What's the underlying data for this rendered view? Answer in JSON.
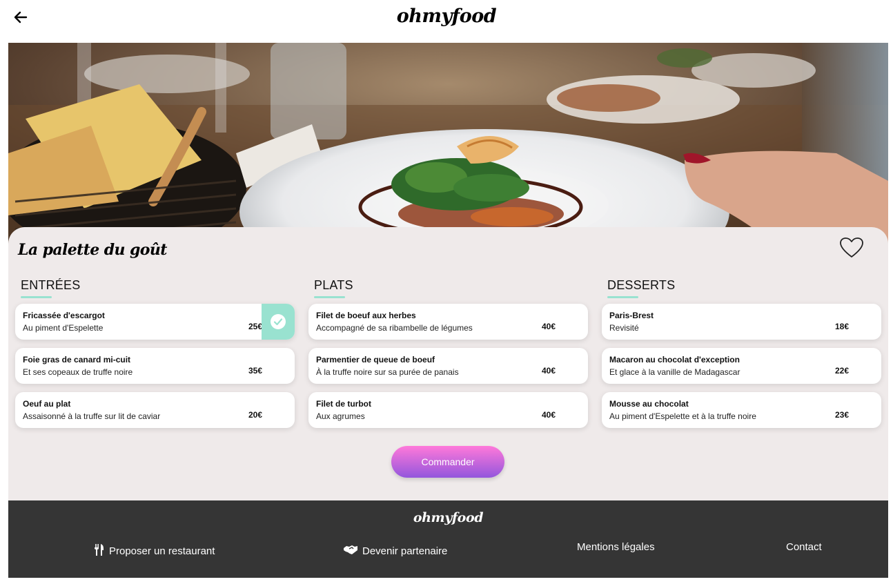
{
  "header": {
    "logo": "ohmyfood"
  },
  "restaurant": {
    "name": "La palette du goût"
  },
  "menu": {
    "columns": [
      {
        "title": "ENTRÉES",
        "items": [
          {
            "name": "Fricassée d'escargot",
            "description": "Au piment d'Espelette",
            "price": "25€",
            "selected": true
          },
          {
            "name": "Foie gras de canard mi-cuit",
            "description": "Et ses copeaux de truffe noire",
            "price": "35€",
            "selected": false
          },
          {
            "name": "Oeuf au plat",
            "description": "Assaisonné à la truffe sur lit de caviar",
            "price": "20€",
            "selected": false
          }
        ]
      },
      {
        "title": "PLATS",
        "items": [
          {
            "name": "Filet de boeuf aux herbes",
            "description": "Accompagné de sa ribambelle de légumes",
            "price": "40€",
            "selected": false
          },
          {
            "name": "Parmentier de queue de boeuf",
            "description": "À la truffe noire sur sa purée de panais",
            "price": "40€",
            "selected": false
          },
          {
            "name": "Filet de turbot",
            "description": "Aux agrumes",
            "price": "40€",
            "selected": false
          }
        ]
      },
      {
        "title": "DESSERTS",
        "items": [
          {
            "name": "Paris-Brest",
            "description": "Revisité",
            "price": "18€",
            "selected": false
          },
          {
            "name": "Macaron au chocolat d'exception",
            "description": "Et glace à la vanille de Madagascar",
            "price": "22€",
            "selected": false
          },
          {
            "name": "Mousse au chocolat",
            "description": "Au piment d'Espelette et à la truffe noire",
            "price": "23€",
            "selected": false
          }
        ]
      }
    ]
  },
  "order_button": "Commander",
  "footer": {
    "logo": "ohmyfood",
    "links": [
      {
        "label": "Proposer un restaurant",
        "icon": "utensils-icon"
      },
      {
        "label": "Devenir partenaire",
        "icon": "handshake-icon"
      },
      {
        "label": "Mentions légales",
        "icon": ""
      },
      {
        "label": "Contact",
        "icon": ""
      }
    ]
  },
  "colors": {
    "accent": "#99e2d0",
    "panel_bg": "#efeaea",
    "footer_bg": "#353535",
    "button_gradient_start": "#ff79da",
    "button_gradient_end": "#9356dc"
  }
}
